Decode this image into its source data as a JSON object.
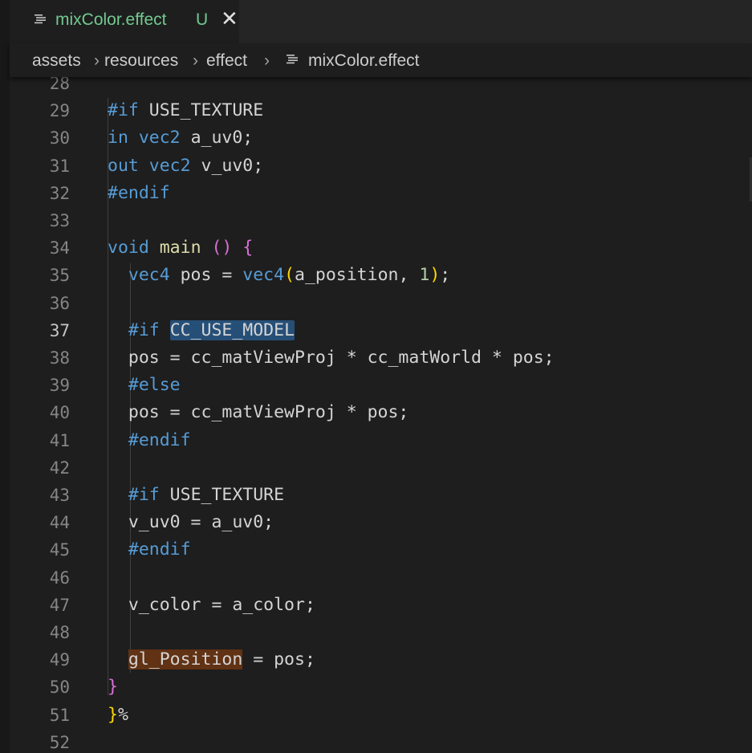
{
  "tab": {
    "file_name": "mixColor.effect",
    "status_badge": "U",
    "close_glyph": "✕"
  },
  "breadcrumb": {
    "items": [
      "assets",
      "resources",
      "effect",
      "mixColor.effect"
    ],
    "separator": "›"
  },
  "editor": {
    "active_line": 37,
    "lines": [
      {
        "n": "28",
        "tokens": []
      },
      {
        "n": "29",
        "tokens": [
          [
            "kw",
            "#if"
          ],
          [
            "txt",
            " USE_TEXTURE"
          ]
        ]
      },
      {
        "n": "30",
        "tokens": [
          [
            "kw",
            "in"
          ],
          [
            "txt",
            " "
          ],
          [
            "kw",
            "vec2"
          ],
          [
            "txt",
            " a_uv0;"
          ]
        ]
      },
      {
        "n": "31",
        "tokens": [
          [
            "kw",
            "out"
          ],
          [
            "txt",
            " "
          ],
          [
            "kw",
            "vec2"
          ],
          [
            "txt",
            " v_uv0;"
          ]
        ]
      },
      {
        "n": "32",
        "tokens": [
          [
            "kw",
            "#endif"
          ]
        ]
      },
      {
        "n": "33",
        "tokens": []
      },
      {
        "n": "34",
        "tokens": [
          [
            "kw",
            "void"
          ],
          [
            "txt",
            " "
          ],
          [
            "fn",
            "main"
          ],
          [
            "txt",
            " "
          ],
          [
            "br1",
            "()"
          ],
          [
            "txt",
            " "
          ],
          [
            "br1",
            "{"
          ]
        ]
      },
      {
        "n": "35",
        "tokens": [
          [
            "txt",
            "  "
          ],
          [
            "kw",
            "vec4"
          ],
          [
            "txt",
            " pos = "
          ],
          [
            "kw",
            "vec4"
          ],
          [
            "br0",
            "("
          ],
          [
            "txt",
            "a_position, "
          ],
          [
            "num",
            "1"
          ],
          [
            "br0",
            ")"
          ],
          [
            "txt",
            ";"
          ]
        ]
      },
      {
        "n": "36",
        "tokens": []
      },
      {
        "n": "37",
        "tokens": [
          [
            "txt",
            "  "
          ],
          [
            "kw",
            "#if"
          ],
          [
            "txt",
            " "
          ],
          [
            "hl-blue",
            "CC_USE_MODEL"
          ]
        ]
      },
      {
        "n": "38",
        "tokens": [
          [
            "txt",
            "  pos = cc_matViewProj * cc_matWorld * pos;"
          ]
        ]
      },
      {
        "n": "39",
        "tokens": [
          [
            "txt",
            "  "
          ],
          [
            "kw",
            "#else"
          ]
        ]
      },
      {
        "n": "40",
        "tokens": [
          [
            "txt",
            "  pos = cc_matViewProj * pos;"
          ]
        ]
      },
      {
        "n": "41",
        "tokens": [
          [
            "txt",
            "  "
          ],
          [
            "kw",
            "#endif"
          ]
        ]
      },
      {
        "n": "42",
        "tokens": []
      },
      {
        "n": "43",
        "tokens": [
          [
            "txt",
            "  "
          ],
          [
            "kw",
            "#if"
          ],
          [
            "txt",
            " USE_TEXTURE"
          ]
        ]
      },
      {
        "n": "44",
        "tokens": [
          [
            "txt",
            "  v_uv0 = a_uv0;"
          ]
        ]
      },
      {
        "n": "45",
        "tokens": [
          [
            "txt",
            "  "
          ],
          [
            "kw",
            "#endif"
          ]
        ]
      },
      {
        "n": "46",
        "tokens": []
      },
      {
        "n": "47",
        "tokens": [
          [
            "txt",
            "  v_color = a_color;"
          ]
        ]
      },
      {
        "n": "48",
        "tokens": []
      },
      {
        "n": "49",
        "tokens": [
          [
            "txt",
            "  "
          ],
          [
            "hl-orange",
            "gl_Position"
          ],
          [
            "txt",
            " = pos;"
          ]
        ]
      },
      {
        "n": "50",
        "tokens": [
          [
            "br1",
            "}"
          ]
        ]
      },
      {
        "n": "51",
        "tokens": [
          [
            "br0",
            "}"
          ],
          [
            "txt",
            "%"
          ]
        ]
      },
      {
        "n": "52",
        "tokens": []
      }
    ]
  },
  "colors": {
    "background": "#1e1e1e",
    "tab_modified_text": "#73c991",
    "keyword": "#569cd6",
    "function": "#dcdcaa",
    "number": "#b5cea8",
    "bracket_level1": "#da70d6",
    "bracket_level0": "#ffd700",
    "selection_highlight": "#264f78",
    "write_highlight": "#613214"
  },
  "icons": {
    "tab_file_icon": "lines-file-icon",
    "breadcrumb_file_icon": "lines-file-icon",
    "close_icon": "close-icon"
  }
}
